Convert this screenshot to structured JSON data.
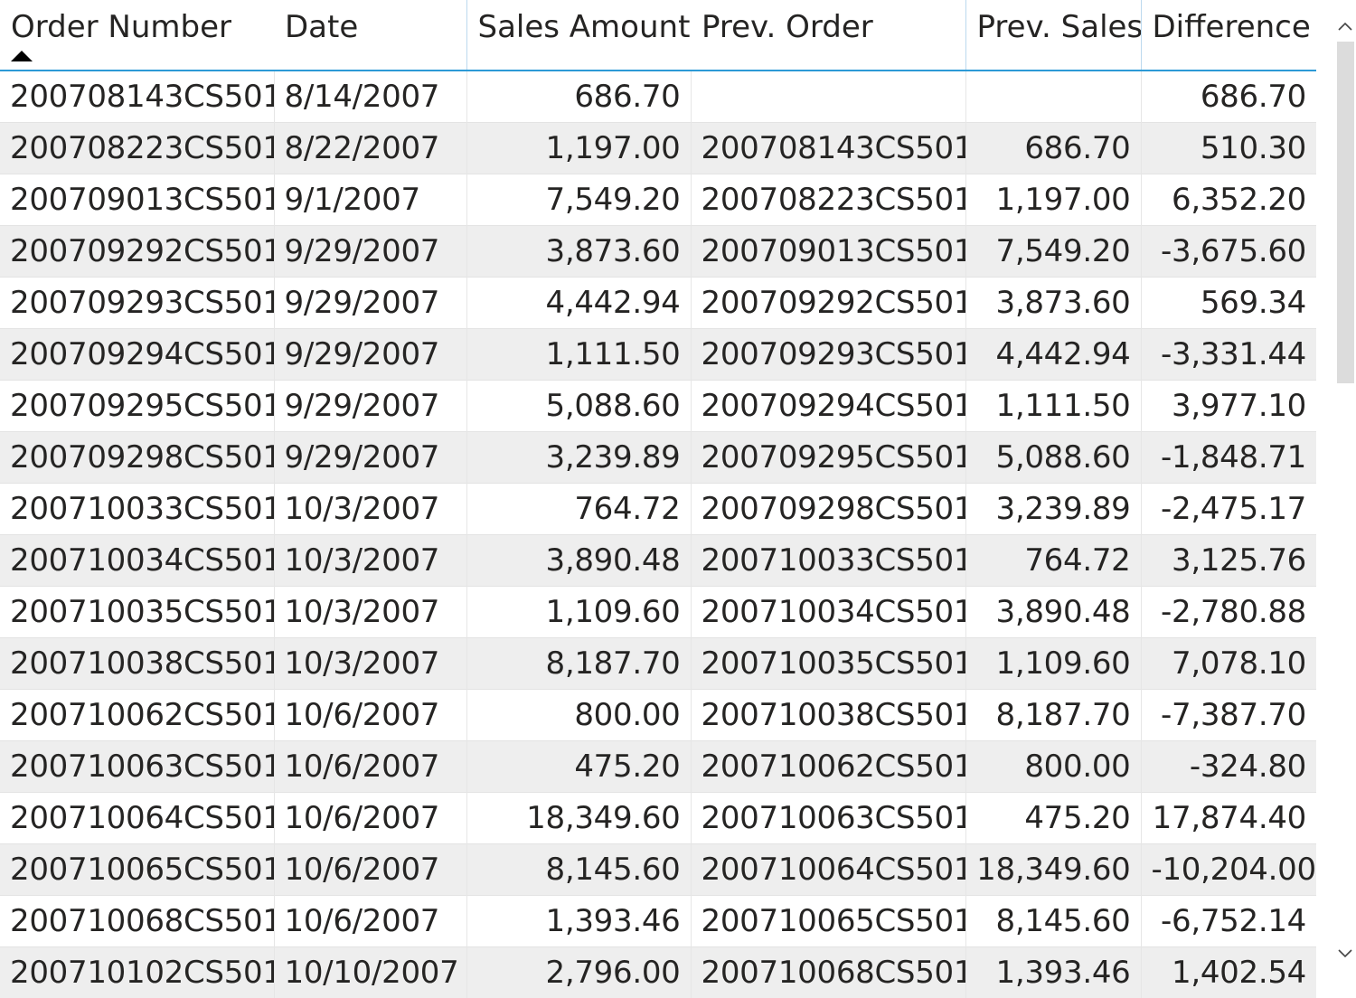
{
  "table": {
    "columns": [
      {
        "label": "Order Number",
        "align": "left",
        "sorted": "ascending"
      },
      {
        "label": "Date",
        "align": "left"
      },
      {
        "label": "Sales Amount",
        "align": "right"
      },
      {
        "label": "Prev. Order",
        "align": "left"
      },
      {
        "label": "Prev. Sales",
        "align": "right"
      },
      {
        "label": "Difference",
        "align": "right"
      }
    ],
    "rows": [
      [
        "200708143CS501",
        "8/14/2007",
        "686.70",
        "",
        "",
        "686.70"
      ],
      [
        "200708223CS501",
        "8/22/2007",
        "1,197.00",
        "200708143CS501",
        "686.70",
        "510.30"
      ],
      [
        "200709013CS501",
        "9/1/2007",
        "7,549.20",
        "200708223CS501",
        "1,197.00",
        "6,352.20"
      ],
      [
        "200709292CS501",
        "9/29/2007",
        "3,873.60",
        "200709013CS501",
        "7,549.20",
        "-3,675.60"
      ],
      [
        "200709293CS501",
        "9/29/2007",
        "4,442.94",
        "200709292CS501",
        "3,873.60",
        "569.34"
      ],
      [
        "200709294CS501",
        "9/29/2007",
        "1,111.50",
        "200709293CS501",
        "4,442.94",
        "-3,331.44"
      ],
      [
        "200709295CS501",
        "9/29/2007",
        "5,088.60",
        "200709294CS501",
        "1,111.50",
        "3,977.10"
      ],
      [
        "200709298CS501",
        "9/29/2007",
        "3,239.89",
        "200709295CS501",
        "5,088.60",
        "-1,848.71"
      ],
      [
        "200710033CS501",
        "10/3/2007",
        "764.72",
        "200709298CS501",
        "3,239.89",
        "-2,475.17"
      ],
      [
        "200710034CS501",
        "10/3/2007",
        "3,890.48",
        "200710033CS501",
        "764.72",
        "3,125.76"
      ],
      [
        "200710035CS501",
        "10/3/2007",
        "1,109.60",
        "200710034CS501",
        "3,890.48",
        "-2,780.88"
      ],
      [
        "200710038CS501",
        "10/3/2007",
        "8,187.70",
        "200710035CS501",
        "1,109.60",
        "7,078.10"
      ],
      [
        "200710062CS501",
        "10/6/2007",
        "800.00",
        "200710038CS501",
        "8,187.70",
        "-7,387.70"
      ],
      [
        "200710063CS501",
        "10/6/2007",
        "475.20",
        "200710062CS501",
        "800.00",
        "-324.80"
      ],
      [
        "200710064CS501",
        "10/6/2007",
        "18,349.60",
        "200710063CS501",
        "475.20",
        "17,874.40"
      ],
      [
        "200710065CS501",
        "10/6/2007",
        "8,145.60",
        "200710064CS501",
        "18,349.60",
        "-10,204.00"
      ],
      [
        "200710068CS501",
        "10/6/2007",
        "1,393.46",
        "200710065CS501",
        "8,145.60",
        "-6,752.14"
      ],
      [
        "200710102CS501",
        "10/10/2007",
        "2,796.00",
        "200710068CS501",
        "1,393.46",
        "1,402.54"
      ]
    ]
  },
  "scrollbar": {
    "up_icon": "chevron-up-icon",
    "down_icon": "chevron-down-icon"
  }
}
